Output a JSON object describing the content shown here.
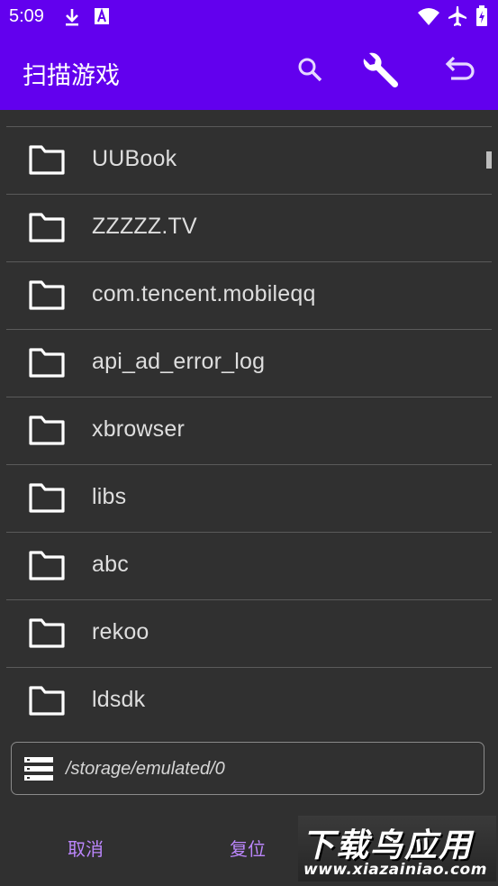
{
  "status_bar": {
    "time": "5:09",
    "left_icons": [
      "download-icon",
      "a-badge-icon"
    ],
    "right_icons": [
      "wifi-icon",
      "airplane-icon",
      "battery-icon"
    ]
  },
  "app_bar": {
    "title": "扫描游戏",
    "actions": [
      "search-icon",
      "wrench-icon",
      "undo-icon"
    ],
    "color": "#6200ee"
  },
  "folders": [
    {
      "name": "UUBook"
    },
    {
      "name": "ZZZZZ.TV"
    },
    {
      "name": "com.tencent.mobileqq"
    },
    {
      "name": "api_ad_error_log"
    },
    {
      "name": "xbrowser"
    },
    {
      "name": "libs"
    },
    {
      "name": "abc"
    },
    {
      "name": "rekoo"
    },
    {
      "name": "ldsdk"
    }
  ],
  "path_bar": {
    "icon": "storage-icon",
    "path": "/storage/emulated/0"
  },
  "footer": {
    "cancel_label": "取消",
    "reset_label": "复位",
    "accent": "#bb86fc"
  },
  "watermark": {
    "title": "下载鸟应用",
    "url": "www.xiazainiao.com"
  }
}
